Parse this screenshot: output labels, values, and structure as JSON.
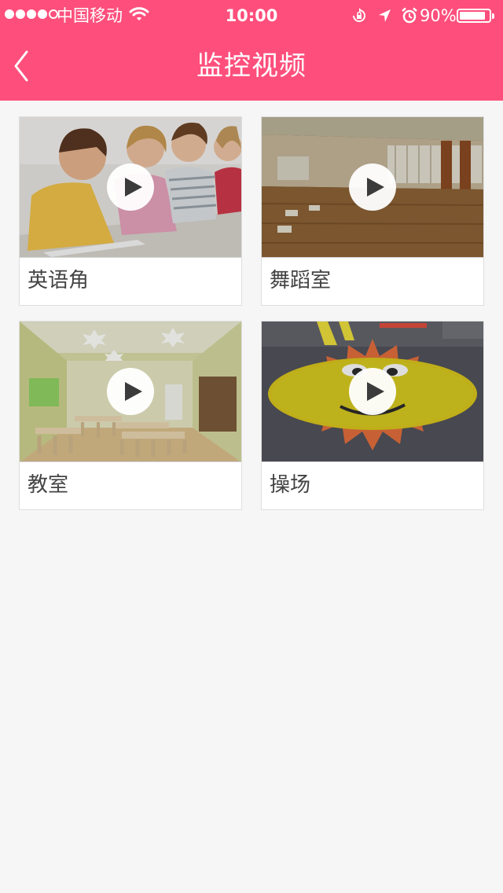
{
  "status_bar": {
    "carrier": "中国移动",
    "time": "10:00",
    "battery": "90%",
    "battery_level": 0.9,
    "signal_bars": 4,
    "icons": [
      "wifi-icon",
      "orientation-lock-icon",
      "location-arrow-icon",
      "alarm-icon",
      "battery-icon"
    ]
  },
  "nav": {
    "title": "监控视频",
    "back_icon": "chevron-left-icon"
  },
  "colors": {
    "accent": "#fe4f7c",
    "background": "#f6f6f6",
    "card": "#ffffff",
    "label_text": "#444444"
  },
  "cameras": [
    {
      "label": "英语角",
      "scene": "children-drawing",
      "icon": "play-icon"
    },
    {
      "label": "舞蹈室",
      "scene": "dance-studio",
      "icon": "play-icon"
    },
    {
      "label": "教室",
      "scene": "classroom",
      "icon": "play-icon"
    },
    {
      "label": "操场",
      "scene": "playground-sun",
      "icon": "play-icon"
    }
  ]
}
